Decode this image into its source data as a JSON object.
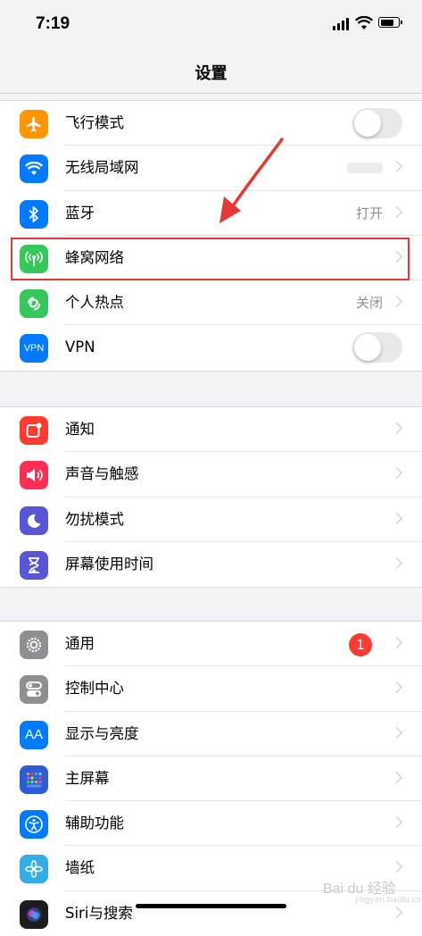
{
  "status_bar": {
    "time": "7:19"
  },
  "nav": {
    "title": "设置"
  },
  "group1": [
    {
      "label": "飞行模式",
      "icon": "airplane-icon",
      "color": "#ff9500",
      "accessory": "toggle"
    },
    {
      "label": "无线局域网",
      "icon": "wifi-icon",
      "color": "#007aff",
      "accessory": "chevron"
    },
    {
      "label": "蓝牙",
      "icon": "bluetooth-icon",
      "color": "#007aff",
      "value": "打开",
      "accessory": "chevron"
    },
    {
      "label": "蜂窝网络",
      "icon": "cellular-antenna-icon",
      "color": "#34c759",
      "accessory": "chevron"
    },
    {
      "label": "个人热点",
      "icon": "hotspot-icon",
      "color": "#34c759",
      "value": "关闭",
      "accessory": "chevron"
    },
    {
      "label": "VPN",
      "icon": "vpn-icon",
      "icon_text": "VPN",
      "color": "#007aff",
      "accessory": "toggle"
    }
  ],
  "group2": [
    {
      "label": "通知",
      "icon": "notifications-icon",
      "color": "#ff3b30"
    },
    {
      "label": "声音与触感",
      "icon": "speaker-icon",
      "color": "#ff2d55"
    },
    {
      "label": "勿扰模式",
      "icon": "moon-icon",
      "color": "#5856d6"
    },
    {
      "label": "屏幕使用时间",
      "icon": "hourglass-icon",
      "color": "#5856d6"
    }
  ],
  "group3": [
    {
      "label": "通用",
      "icon": "gear-icon",
      "color": "#8e8e93",
      "badge": "1"
    },
    {
      "label": "控制中心",
      "icon": "switches-icon",
      "color": "#8e8e93"
    },
    {
      "label": "显示与亮度",
      "icon": "text-size-icon",
      "icon_text": "AA",
      "color": "#007aff"
    },
    {
      "label": "主屏幕",
      "icon": "home-screen-grid-icon",
      "color": "#2c5cd6"
    },
    {
      "label": "辅助功能",
      "icon": "accessibility-icon",
      "color": "#007aff"
    },
    {
      "label": "墙纸",
      "icon": "wallpaper-flower-icon",
      "color": "#32ade6"
    },
    {
      "label": "Siri与搜索",
      "icon": "siri-icon",
      "color": "#1c1c1e"
    }
  ],
  "watermark": {
    "text": "Bai du 经验",
    "sub": "jingyan.baidu.com"
  },
  "colors": {
    "highlight": "#e43a36",
    "background": "#f2f2f7"
  }
}
